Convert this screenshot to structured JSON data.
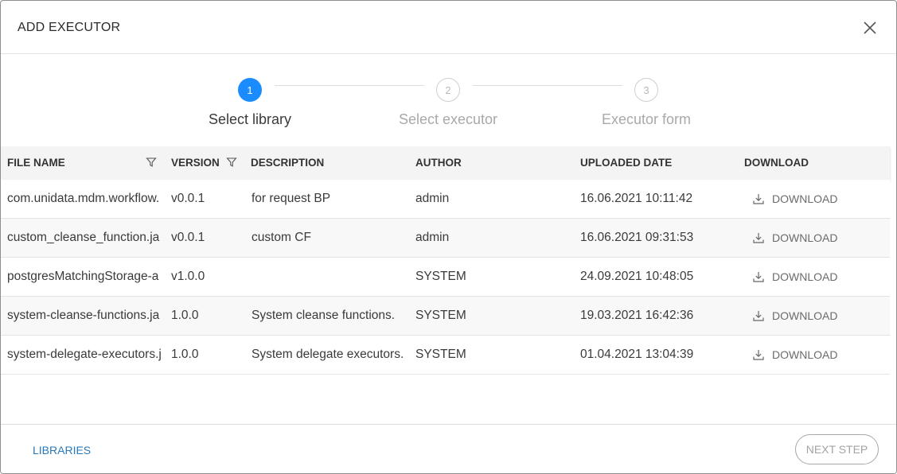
{
  "dialog": {
    "title": "ADD EXECUTOR",
    "close_icon": "close-icon"
  },
  "stepper": {
    "steps": [
      {
        "number": "1",
        "label": "Select library",
        "state": "active"
      },
      {
        "number": "2",
        "label": "Select executor",
        "state": "inactive"
      },
      {
        "number": "3",
        "label": "Executor form",
        "state": "inactive"
      }
    ],
    "active_color": "#1a8cff"
  },
  "table": {
    "columns": {
      "file_name": "FILE NAME",
      "version": "VERSION",
      "description": "DESCRIPTION",
      "author": "AUTHOR",
      "uploaded_date": "UPLOADED DATE",
      "download": "DOWNLOAD"
    },
    "filter_icon": "filter-icon",
    "rows": [
      {
        "file_name": "com.unidata.mdm.workflow.",
        "version": "v0.0.1",
        "description": "for request BP",
        "author": "admin",
        "uploaded_date": "16.06.2021 10:11:42",
        "download": "DOWNLOAD"
      },
      {
        "file_name": "custom_cleanse_function.ja",
        "version": "v0.0.1",
        "description": "custom CF",
        "author": "admin",
        "uploaded_date": "16.06.2021 09:31:53",
        "download": "DOWNLOAD"
      },
      {
        "file_name": "postgresMatchingStorage-a",
        "version": "v1.0.0",
        "description": "",
        "author": "SYSTEM",
        "uploaded_date": "24.09.2021 10:48:05",
        "download": "DOWNLOAD"
      },
      {
        "file_name": "system-cleanse-functions.ja",
        "version": "1.0.0",
        "description": "System cleanse functions.",
        "author": "SYSTEM",
        "uploaded_date": "19.03.2021 16:42:36",
        "download": "DOWNLOAD"
      },
      {
        "file_name": "system-delegate-executors.j",
        "version": "1.0.0",
        "description": "System delegate executors.",
        "author": "SYSTEM",
        "uploaded_date": "01.04.2021 13:04:39",
        "download": "DOWNLOAD"
      }
    ]
  },
  "footer": {
    "libraries_label": "LIBRARIES",
    "next_step_label": "NEXT STEP"
  }
}
